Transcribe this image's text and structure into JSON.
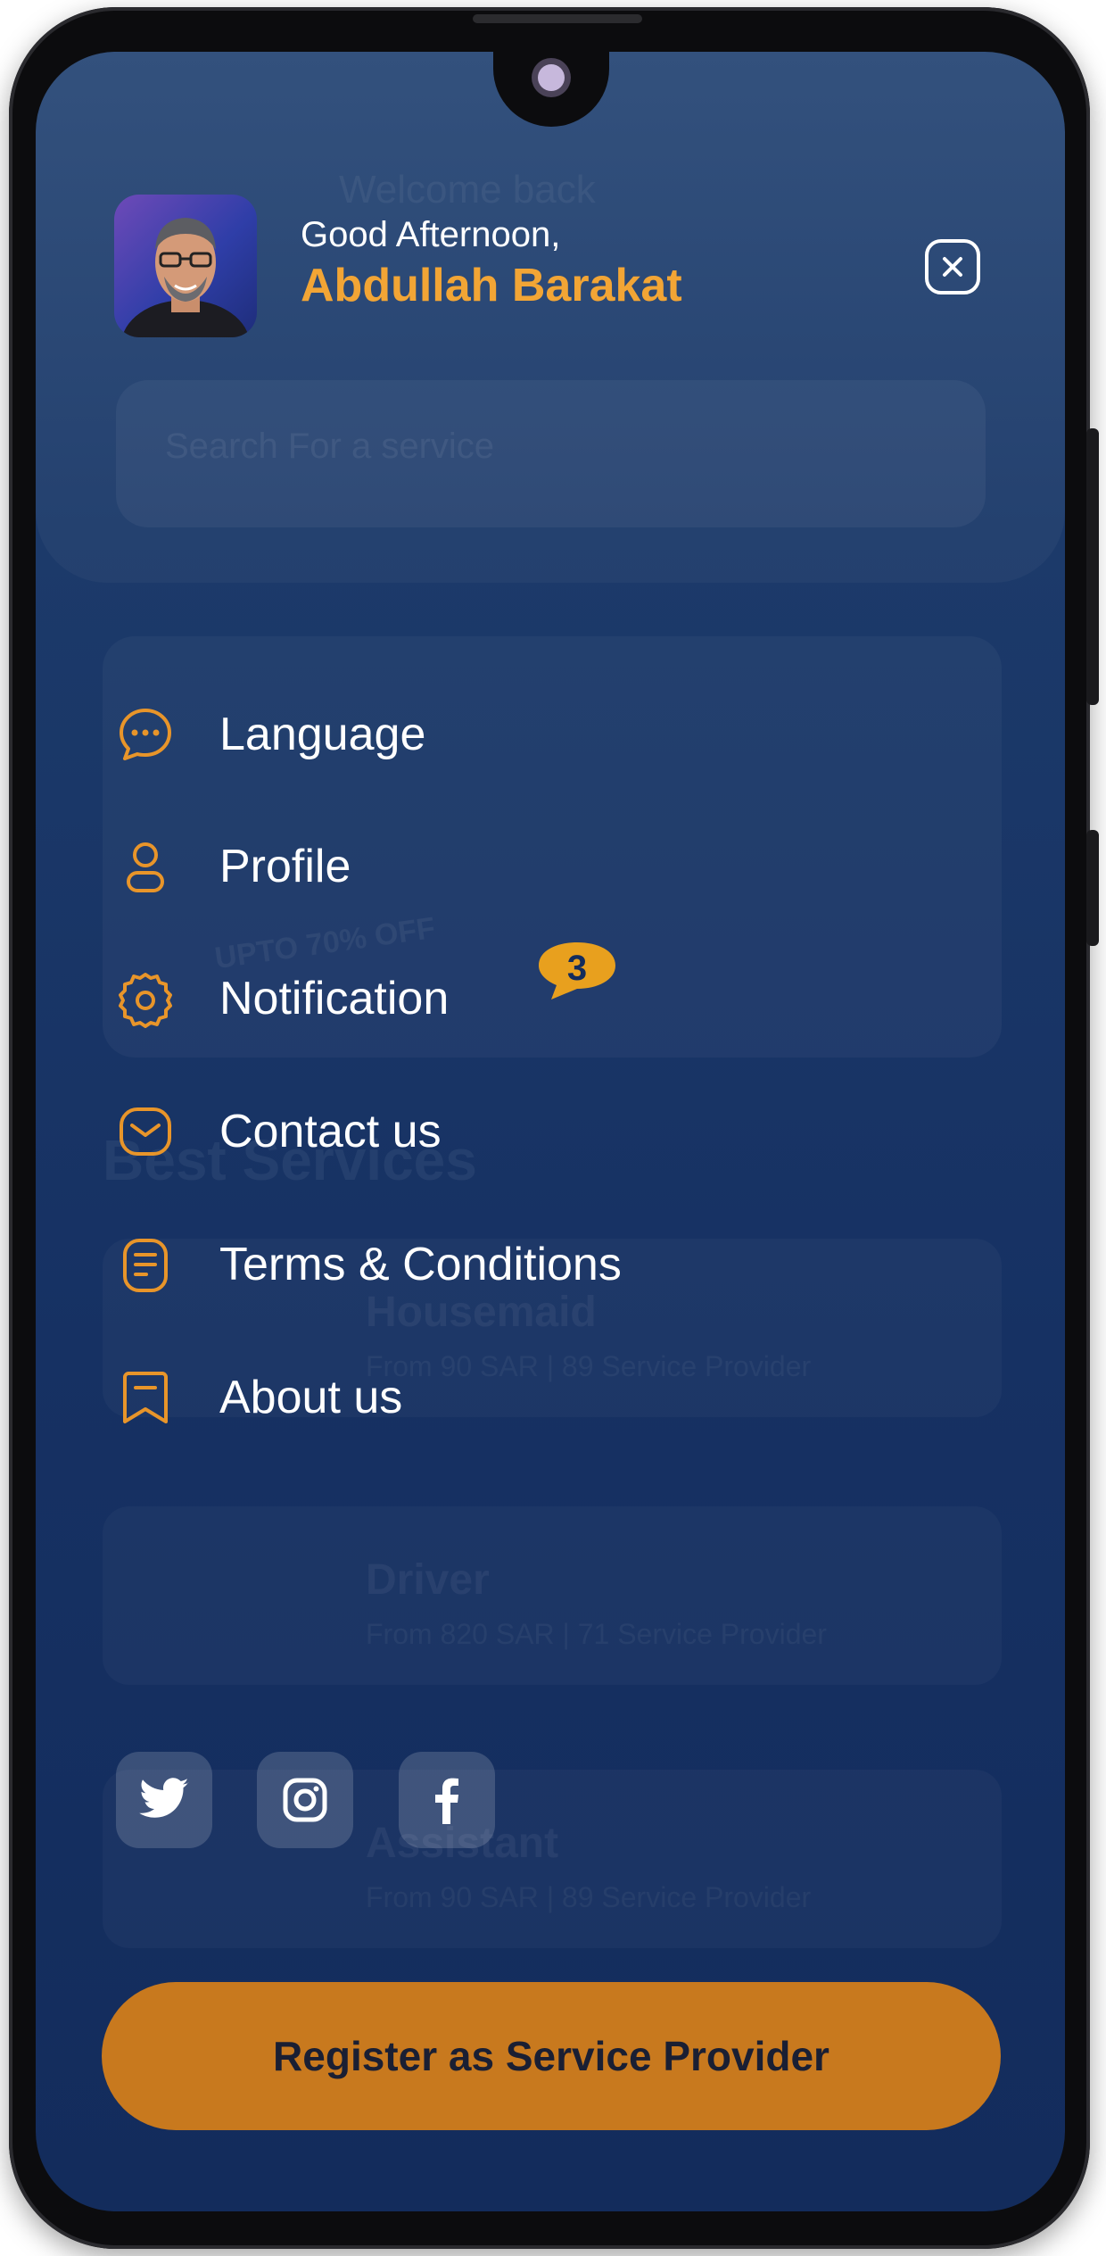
{
  "header": {
    "greeting": "Good Afternoon,",
    "user_name": "Abdullah Barakat"
  },
  "background": {
    "welcome_text": "Welcome back",
    "search_placeholder": "Search For a service",
    "banner_text": "UPTO 70% OFF",
    "section_title": "Best Services",
    "services": [
      {
        "name": "Housemaid",
        "details": "From 90 SAR   |   89 Service Provider"
      },
      {
        "name": "Driver",
        "details": "From 820 SAR   |   71 Service Provider"
      },
      {
        "name": "Assistant",
        "details": "From 90 SAR   |   89 Service Provider"
      }
    ]
  },
  "menu": {
    "items": [
      {
        "label": "Language",
        "icon": "chat-bubble-icon"
      },
      {
        "label": "Profile",
        "icon": "user-icon"
      },
      {
        "label": "Notification",
        "icon": "gear-icon",
        "badge": "3"
      },
      {
        "label": "Contact us",
        "icon": "mail-icon"
      },
      {
        "label": "Terms & Conditions",
        "icon": "document-icon"
      },
      {
        "label": "About us",
        "icon": "bookmark-icon"
      }
    ]
  },
  "social": [
    "twitter-icon",
    "instagram-icon",
    "facebook-icon"
  ],
  "register_button": "Register as Service Provider",
  "colors": {
    "accent": "#f2a535",
    "button": "#c8791e",
    "background": "#163163"
  }
}
